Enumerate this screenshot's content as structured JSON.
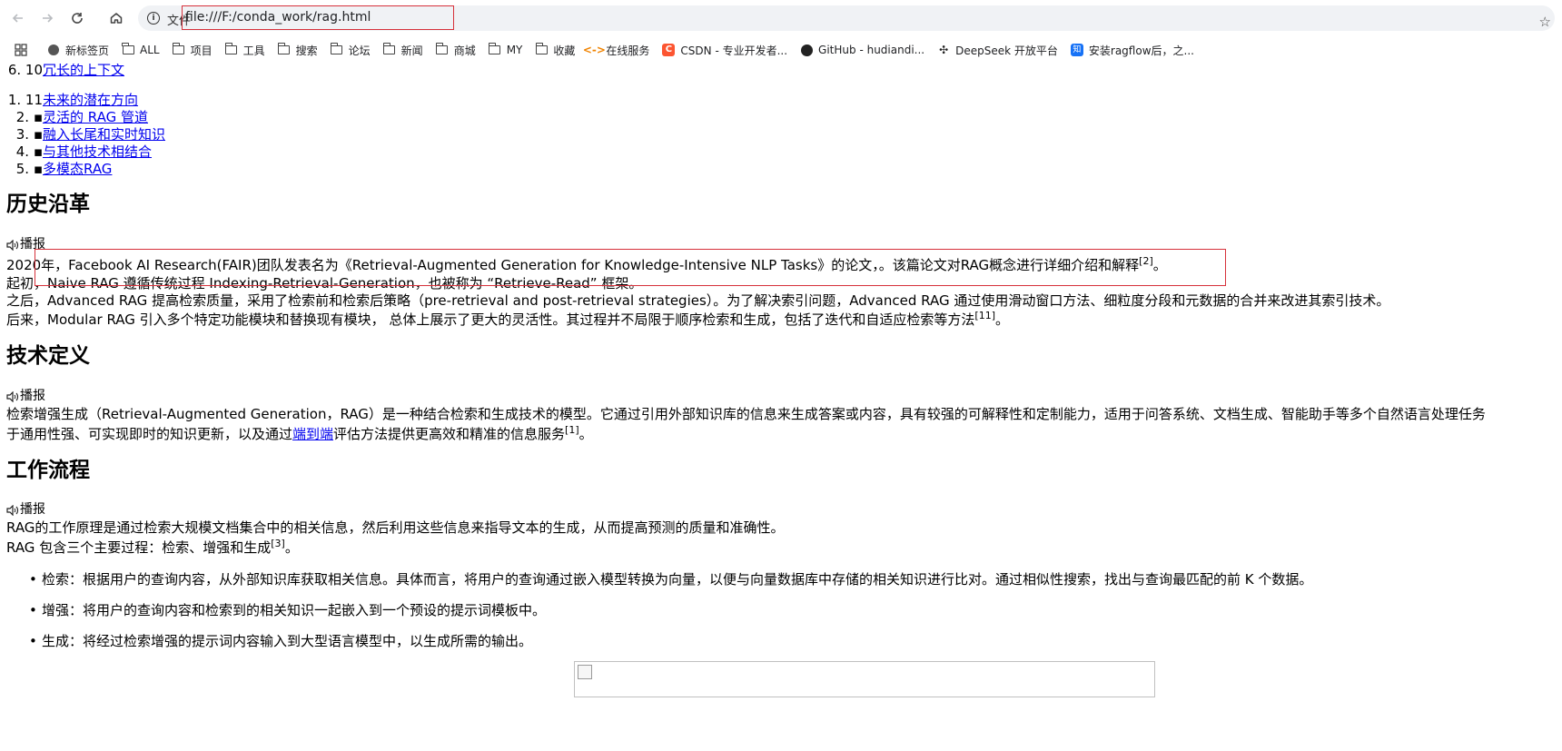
{
  "browser": {
    "back_icon": "arrow-left-icon",
    "forward_icon": "arrow-right-icon",
    "reload_icon": "reload-icon",
    "home_icon": "home-icon",
    "scheme_label": "文件",
    "url": "file:///F:/conda_work/rag.html",
    "bookmarks": [
      {
        "label": "新标签页",
        "icon": "globe-icon"
      },
      {
        "label": "ALL",
        "icon": "folder-icon"
      },
      {
        "label": "项目",
        "icon": "folder-icon"
      },
      {
        "label": "工具",
        "icon": "folder-icon"
      },
      {
        "label": "搜索",
        "icon": "folder-icon"
      },
      {
        "label": "论坛",
        "icon": "folder-icon"
      },
      {
        "label": "新闻",
        "icon": "folder-icon"
      },
      {
        "label": "商城",
        "icon": "folder-icon"
      },
      {
        "label": "MY",
        "icon": "folder-icon"
      },
      {
        "label": "收藏",
        "icon": "folder-icon"
      },
      {
        "label": "在线服务",
        "icon": "online-service-icon"
      },
      {
        "label": "CSDN - 专业开发者...",
        "icon": "csdn-icon"
      },
      {
        "label": "GitHub - hudiandi...",
        "icon": "github-icon"
      },
      {
        "label": "DeepSeek 开放平台",
        "icon": "deepseek-icon"
      },
      {
        "label": "安装ragflow后，之...",
        "icon": "zhihu-icon"
      }
    ]
  },
  "toc": {
    "partial_item": {
      "num": "6. 10",
      "link": "冗长的上下文"
    },
    "items": [
      {
        "num": "1. 11",
        "link": "未来的潜在方向"
      },
      {
        "num": "2. ▪",
        "link": "灵活的 RAG 管道"
      },
      {
        "num": "3. ▪",
        "link": "融入长尾和实时知识"
      },
      {
        "num": "4. ▪",
        "link": "与其他技术相结合"
      },
      {
        "num": "5. ▪",
        "link": "多模态RAG"
      }
    ]
  },
  "history": {
    "heading": "历史沿革",
    "speak": "播报",
    "p1": "2020年，Facebook AI Research(FAIR)团队发表名为《Retrieval-Augmented Generation for Knowledge-Intensive NLP Tasks》的论文，。该篇论文对RAG概念进行详细介绍和解释",
    "p1_ref": "[2]",
    "p1_end": "。",
    "p2": "起初，Naive RAG 遵循传统过程 Indexing-Retrieval-Generation，也被称为 “Retrieve-Read” 框架。",
    "p3": "之后，Advanced RAG 提高检索质量，采用了检索前和检索后策略（pre-retrieval and post-retrieval strategies）。为了解决索引问题，Advanced RAG 通过使用滑动窗口方法、细粒度分段和元数据的合并来改进其索引技术。",
    "p4": "后来，Modular RAG 引入多个特定功能模块和替换现有模块， 总体上展示了更大的灵活性。其过程并不局限于顺序检索和生成，包括了迭代和自适应检索等方法",
    "p4_ref": "[11]",
    "p4_end": "。"
  },
  "definition": {
    "heading": "技术定义",
    "speak": "播报",
    "p1": "检索增强生成（Retrieval-Augmented Generation，RAG）是一种结合检索和生成技术的模型。它通过引用外部知识库的信息来生成答案或内容，具有较强的可解释性和定制能力，适用于问答系统、文档生成、智能助手等多个自然语言处理任务",
    "p2_pre": "于通用性强、可实现即时的知识更新，以及通过",
    "p2_link": "端到端",
    "p2_post": "评估方法提供更高效和精准的信息服务",
    "p2_ref": "[1]",
    "p2_end": "。"
  },
  "workflow": {
    "heading": "工作流程",
    "speak": "播报",
    "p1": "RAG的工作原理是通过检索大规模文档集合中的相关信息，然后利用这些信息来指导文本的生成，从而提高预测的质量和准确性。",
    "p2": "RAG 包含三个主要过程：检索、增强和生成",
    "p2_ref": "[3]",
    "p2_end": "。",
    "bullets": [
      "检索：根据用户的查询内容，从外部知识库获取相关信息。具体而言，将用户的查询通过嵌入模型转换为向量，以便与向量数据库中存储的相关知识进行比对。通过相似性搜索，找出与查询最匹配的前 K 个数据。",
      "增强：将用户的查询内容和检索到的相关知识一起嵌入到一个预设的提示词模板中。",
      "生成：将经过检索增强的提示词内容输入到大型语言模型中，以生成所需的输出。"
    ]
  }
}
